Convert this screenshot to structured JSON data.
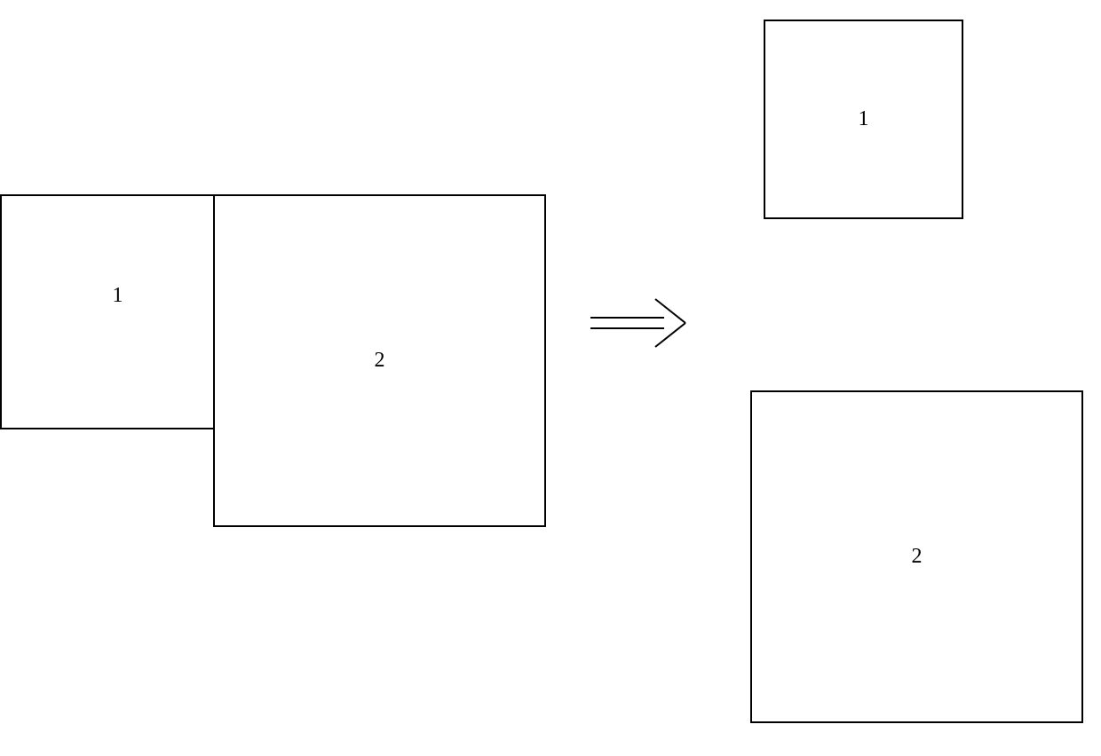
{
  "diagram": {
    "left_box_1": {
      "label": "1"
    },
    "left_box_2": {
      "label": "2"
    },
    "right_box_1": {
      "label": "1"
    },
    "right_box_2": {
      "label": "2"
    }
  }
}
